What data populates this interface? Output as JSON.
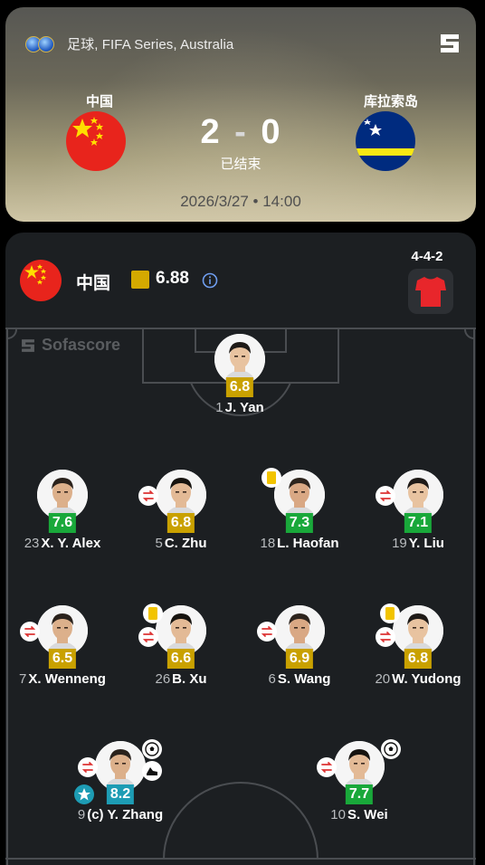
{
  "match": {
    "competition": "足球, FIFA Series, Australia",
    "home_team": "中国",
    "away_team": "库拉索岛",
    "home_score": "2",
    "away_score": "0",
    "score_separator": "-",
    "status": "已结束",
    "datetime": "2026/3/27 • 14:00"
  },
  "lineup": {
    "team_name": "中国",
    "team_rating": "6.88",
    "formation": "4-4-2",
    "watermark": "Sofascore",
    "players": [
      {
        "id": "gk",
        "number": "1",
        "name": "J. Yan",
        "rating": "6.8",
        "rating_color": "yellow"
      },
      {
        "id": "d1",
        "number": "23",
        "name": "X. Y. Alex",
        "rating": "7.6",
        "rating_color": "green"
      },
      {
        "id": "d2",
        "number": "5",
        "name": "C. Zhu",
        "rating": "6.8",
        "rating_color": "yellow"
      },
      {
        "id": "d3",
        "number": "18",
        "name": "L. Haofan",
        "rating": "7.3",
        "rating_color": "green"
      },
      {
        "id": "d4",
        "number": "19",
        "name": "Y. Liu",
        "rating": "7.1",
        "rating_color": "green"
      },
      {
        "id": "m1",
        "number": "7",
        "name": "X. Wenneng",
        "rating": "6.5",
        "rating_color": "yellow"
      },
      {
        "id": "m2",
        "number": "26",
        "name": "B. Xu",
        "rating": "6.6",
        "rating_color": "yellow"
      },
      {
        "id": "m3",
        "number": "6",
        "name": "S. Wang",
        "rating": "6.9",
        "rating_color": "yellow"
      },
      {
        "id": "m4",
        "number": "20",
        "name": "W. Yudong",
        "rating": "6.8",
        "rating_color": "yellow"
      },
      {
        "id": "f1",
        "number": "9",
        "name": "(c) Y. Zhang",
        "rating": "8.2",
        "rating_color": "teal"
      },
      {
        "id": "f2",
        "number": "10",
        "name": "S. Wei",
        "rating": "7.7",
        "rating_color": "green"
      }
    ]
  },
  "colors": {
    "rating_yellow": "#c9a100",
    "rating_green": "#19a83a",
    "rating_teal": "#1d9cb4",
    "card_bg": "#1c1f22",
    "kit_red": "#e8262b"
  },
  "icons": [
    "competition-icon",
    "sofascore-logo-icon",
    "info-icon",
    "jersey-icon",
    "substitution-icon",
    "yellow-card-icon",
    "goal-icon",
    "assist-boot-icon",
    "player-of-match-star-icon"
  ]
}
